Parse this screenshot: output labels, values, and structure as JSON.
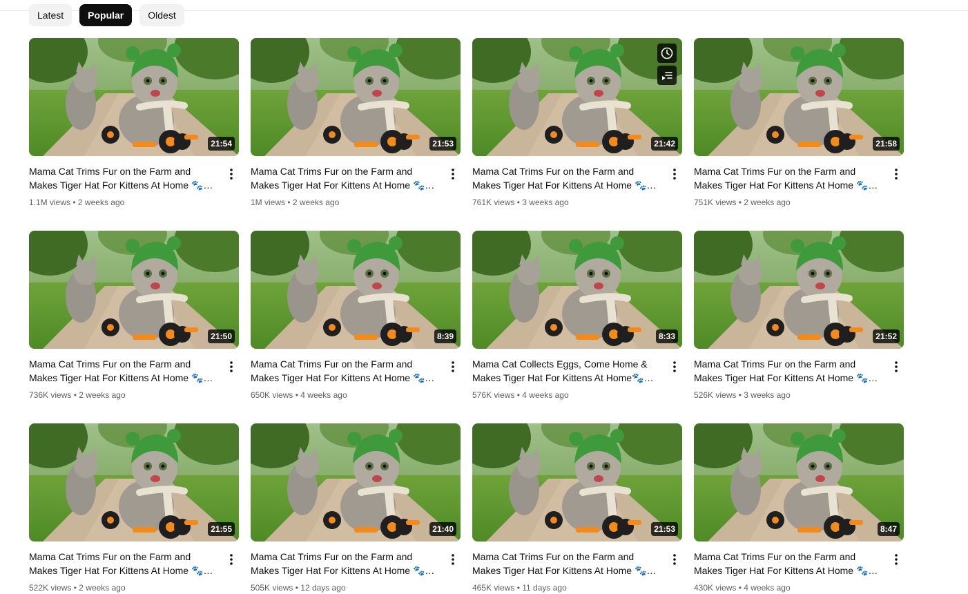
{
  "filters": [
    "Latest",
    "Popular",
    "Oldest"
  ],
  "active_filter": "Popular",
  "colors": {
    "chip_active": "#0f0f0f",
    "chip_idle": "#f2f2f2",
    "meta_text": "#606060"
  },
  "videos": [
    {
      "title": "Mama Cat Trims Fur on the Farm and Makes Tiger Hat For Kittens At Home 🐾🍀🎩",
      "duration": "21:54",
      "views": "1.1M views",
      "age": "2 weeks ago"
    },
    {
      "title": "Mama Cat Trims Fur on the Farm and Makes Tiger Hat For Kittens At Home 🐾🍀🎩",
      "duration": "21:53",
      "views": "1M views",
      "age": "2 weeks ago"
    },
    {
      "title": "Mama Cat Trims Fur on the Farm and Makes Tiger Hat For Kittens At Home 🐾🍀🎩",
      "duration": "21:42",
      "views": "761K views",
      "age": "3 weeks ago",
      "hovered": true
    },
    {
      "title": "Mama Cat Trims Fur on the Farm and Makes Tiger Hat For Kittens At Home 🐾🍀🎩",
      "duration": "21:58",
      "views": "751K views",
      "age": "2 weeks ago"
    },
    {
      "title": "Mama Cat Trims Fur on the Farm and Makes Tiger Hat For Kittens At Home 🐾🍀🎩",
      "duration": "21:50",
      "views": "736K views",
      "age": "2 weeks ago"
    },
    {
      "title": "Mama Cat Trims Fur on the Farm and Makes Tiger Hat For Kittens At Home 🐾🍀🎩",
      "duration": "8:39",
      "views": "650K views",
      "age": "4 weeks ago"
    },
    {
      "title": "Mama Cat Collects Eggs, Come Home & Makes Tiger Hat For Kittens At Home🐾🍀🎩",
      "duration": "8:33",
      "views": "576K views",
      "age": "4 weeks ago"
    },
    {
      "title": "Mama Cat Trims Fur on the Farm and Makes Tiger Hat For Kittens At Home 🐾🍀🎩",
      "duration": "21:52",
      "views": "526K views",
      "age": "3 weeks ago"
    },
    {
      "title": "Mama Cat Trims Fur on the Farm and Makes Tiger Hat For Kittens At Home 🐾🍀🎩",
      "duration": "21:55",
      "views": "522K views",
      "age": "2 weeks ago"
    },
    {
      "title": "Mama Cat Trims Fur on the Farm and Makes Tiger Hat For Kittens At Home 🐾🍀🎩",
      "duration": "21:40",
      "views": "505K views",
      "age": "12 days ago"
    },
    {
      "title": "Mama Cat Trims Fur on the Farm and Makes Tiger Hat For Kittens At Home 🐾🍀🎩",
      "duration": "21:53",
      "views": "465K views",
      "age": "11 days ago"
    },
    {
      "title": "Mama Cat Trims Fur on the Farm and Makes Tiger Hat For Kittens At Home 🐾🍀🎩",
      "duration": "8:47",
      "views": "430K views",
      "age": "4 weeks ago"
    }
  ]
}
